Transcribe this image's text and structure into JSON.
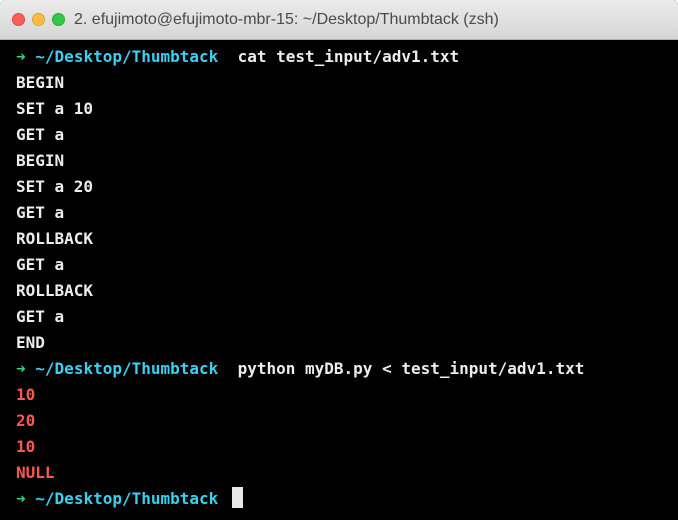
{
  "window": {
    "title": "2. efujimoto@efujimoto-mbr-15: ~/Desktop/Thumbtack (zsh)"
  },
  "colors": {
    "prompt_arrow": "#35d37b",
    "prompt_path": "#3ad0f0",
    "text": "#ececec",
    "output": "#f55a4e",
    "background": "#000000"
  },
  "terminal": {
    "prompt": {
      "arrow": "➜",
      "path": "~/Desktop/Thumbtack"
    },
    "commands": [
      "cat test_input/adv1.txt",
      "python myDB.py < test_input/adv1.txt"
    ],
    "file_lines": [
      "BEGIN",
      "SET a 10",
      "GET a",
      "BEGIN",
      "SET a 20",
      "GET a",
      "ROLLBACK",
      "GET a",
      "ROLLBACK",
      "GET a",
      "END"
    ],
    "program_output": [
      "10",
      "20",
      "10",
      "NULL"
    ]
  }
}
